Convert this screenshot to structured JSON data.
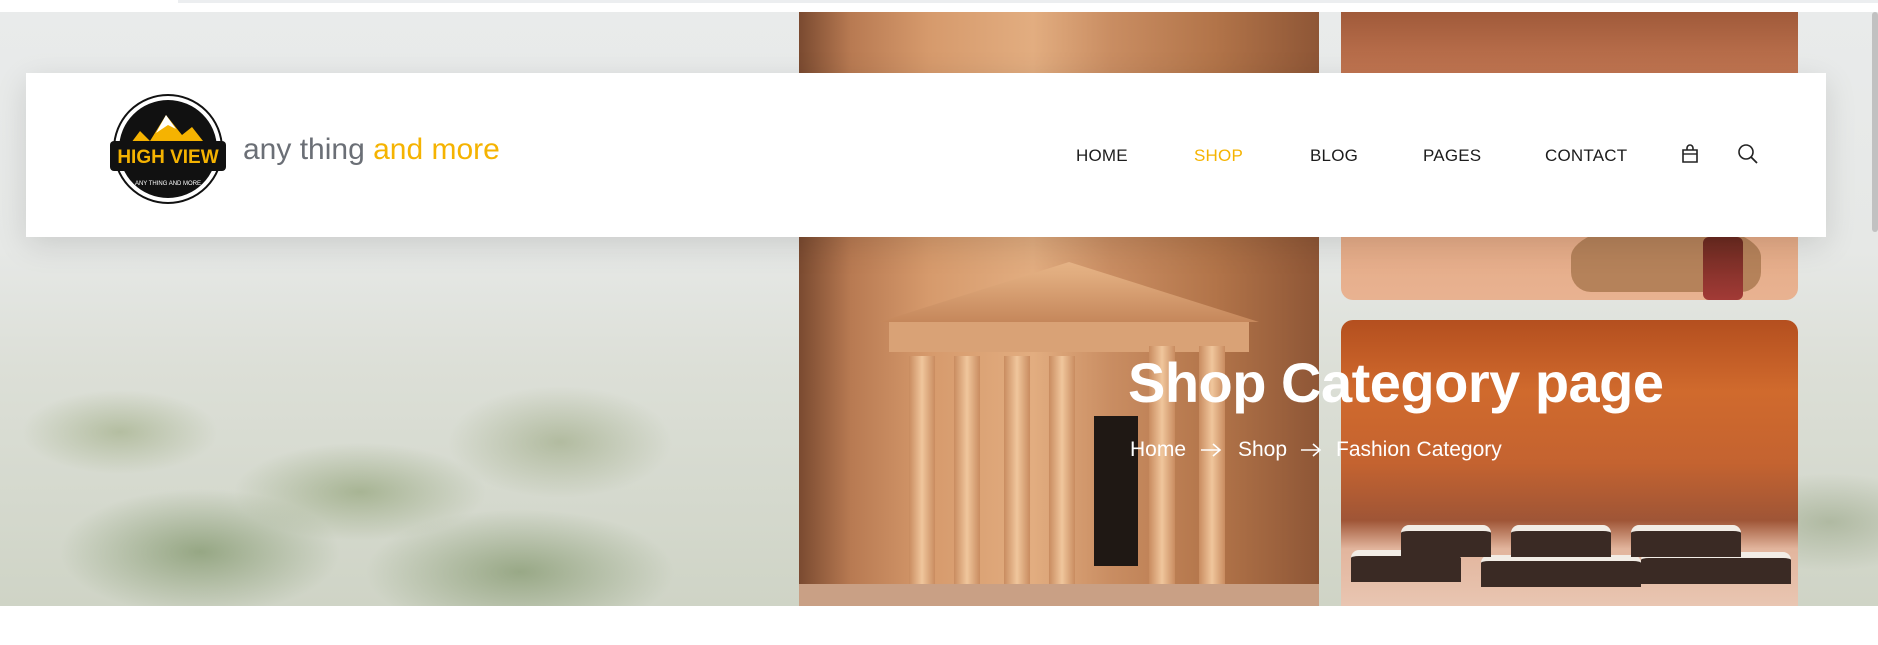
{
  "header": {
    "logo_text": "HIGH VIEW",
    "logo_subtext": "ANY THING AND MORE",
    "tagline_start": "any thing ",
    "tagline_accent": "and more"
  },
  "nav": {
    "items": [
      {
        "label": "HOME"
      },
      {
        "label": "SHOP",
        "active": true
      },
      {
        "label": "BLOG"
      },
      {
        "label": "PAGES"
      },
      {
        "label": "CONTACT"
      }
    ],
    "icons": [
      "cart-bag-icon",
      "search-icon"
    ]
  },
  "hero": {
    "title": "Shop Category page",
    "breadcrumb": [
      "Home",
      "Shop",
      "Fashion Category"
    ]
  },
  "colors": {
    "accent": "#f5b301",
    "nav_text": "#1c1c1c",
    "tagline_gray": "#6b6f76"
  }
}
